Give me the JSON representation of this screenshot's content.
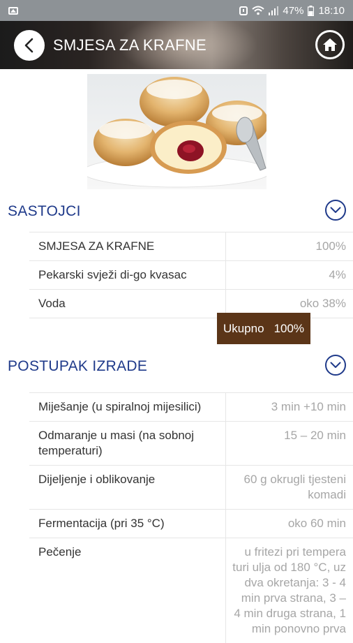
{
  "status": {
    "battery": "47%",
    "time": "18:10"
  },
  "header": {
    "title": "SMJESA ZA KRAFNE"
  },
  "ingredients": {
    "title": "SASTOJCI",
    "rows": [
      {
        "name": "SMJESA ZA KRAFNE",
        "value": "100%"
      },
      {
        "name": "Pekarski svježi di-go kvasac",
        "value": "4%"
      },
      {
        "name": "Voda",
        "value": "oko 38%"
      }
    ],
    "total_label": "Ukupno",
    "total_value": "100%"
  },
  "procedure": {
    "title": "POSTUPAK IZRADE",
    "rows": [
      {
        "step": "Miješanje (u spiralnoj mijesilici)",
        "value": "3 min +10 min"
      },
      {
        "step": "Odmaranje u masi (na sobnoj temperaturi)",
        "value": "15 – 20 min"
      },
      {
        "step": "Dijeljenje i oblikovanje",
        "value": "60 g okrugli tjesteni komadi"
      },
      {
        "step": "Fermentacija (pri 35 °C)",
        "value": "oko 60 min"
      },
      {
        "step": "Pečenje",
        "value": "u fritezi pri tempera turi ulja od 180 °C, uz dva okretanja: 3 - 4 min prva strana, 3 – 4 min druga strana, 1 min ponovno prva"
      }
    ]
  }
}
